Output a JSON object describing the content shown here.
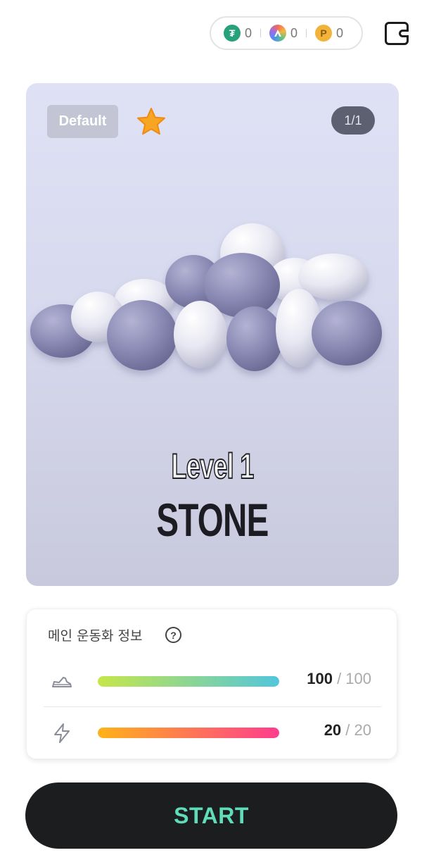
{
  "header": {
    "currencies": [
      {
        "icon": "tether-coin-icon",
        "symbol": "₮",
        "value": "0",
        "color": "#26a17b"
      },
      {
        "icon": "a-token-icon",
        "symbol": "",
        "value": "0",
        "color": "#7b6ee8"
      },
      {
        "icon": "p-point-icon",
        "symbol": "P",
        "value": "0",
        "color": "#f2b33a"
      }
    ],
    "wallet_icon": "wallet-icon"
  },
  "card": {
    "badge": "Default",
    "favorite_icon": "star-icon",
    "page_indicator": "1/1",
    "sneaker_image": "stone-sneaker-image",
    "level": "Level 1",
    "name": "STONE"
  },
  "info": {
    "title": "메인 운동화 정보",
    "help_icon": "question-icon",
    "stats": [
      {
        "icon": "sneaker-icon",
        "current": "100",
        "max": "/ 100",
        "fill": 1.0,
        "gradient": [
          "#c6e64a",
          "#52c6dc"
        ]
      },
      {
        "icon": "lightning-icon",
        "current": "20",
        "max": "/ 20",
        "fill": 1.0,
        "gradient": [
          "#ffb21a",
          "#ff3d8e"
        ]
      }
    ]
  },
  "start_button": {
    "label": "START"
  }
}
